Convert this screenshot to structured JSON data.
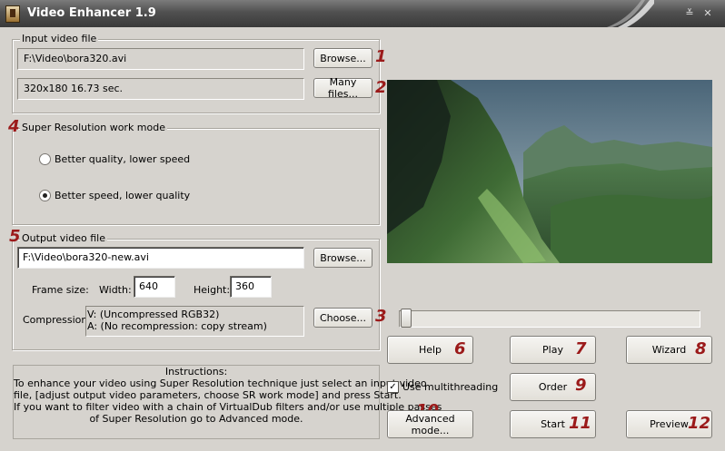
{
  "window": {
    "title": "Video Enhancer 1.9",
    "minimize_glyph": "≚",
    "close_glyph": "✕"
  },
  "input": {
    "group_label": "Input video file",
    "path": "F:\\Video\\bora320.avi",
    "info": "320x180 16.73 sec.",
    "browse_label": "Browse...",
    "many_files_label": "Many files..."
  },
  "mode": {
    "group_label": "Super Resolution work mode",
    "options": [
      {
        "label": "Better quality, lower speed",
        "selected": false
      },
      {
        "label": "Better speed, lower quality",
        "selected": true
      }
    ]
  },
  "output": {
    "group_label": "Output video file",
    "path": "F:\\Video\\bora320-new.avi",
    "browse_label": "Browse...",
    "frame_size_label": "Frame size:",
    "width_label": "Width:",
    "width_value": "640",
    "height_label": "Height:",
    "height_value": "360",
    "compression_label": "Compression:",
    "compression_video": "V: (Uncompressed RGB32)",
    "compression_audio": "A: (No recompression: copy stream)",
    "choose_label": "Choose..."
  },
  "instructions": {
    "title": "Instructions:",
    "lines": [
      "To enhance your video using Super Resolution technique just select an input video",
      "file, [adjust output video parameters, choose SR work mode] and press Start.",
      "If you want to filter video with a chain of VirtualDub filters and/or use multiple passes",
      "of Super Resolution go to Advanced mode."
    ]
  },
  "controls": {
    "seek_position": 0.0,
    "help_label": "Help",
    "play_label": "Play",
    "wizard_label": "Wizard",
    "multithreading_label": "Use multithreading",
    "multithreading_checked": true,
    "check_glyph": "✓",
    "order_label": "Order",
    "advanced_label": "Advanced mode...",
    "start_label": "Start",
    "preview_label": "Preview"
  },
  "annotations": [
    "1",
    "2",
    "3",
    "4",
    "5",
    "6",
    "7",
    "8",
    "9",
    "10",
    "11",
    "12"
  ],
  "colors": {
    "titlebar": "#4a4a4a",
    "annotation": "#9b1a1a",
    "dialog": "#d6d3ce"
  }
}
